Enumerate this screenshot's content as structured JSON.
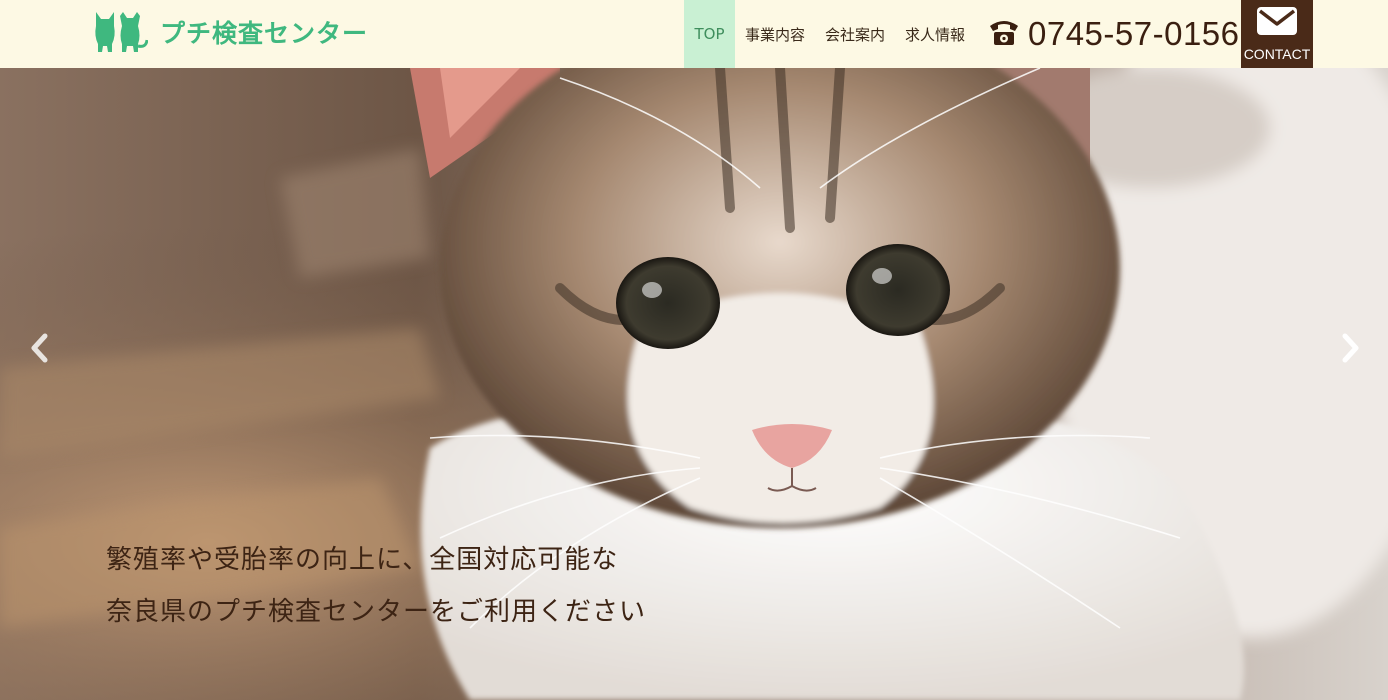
{
  "header": {
    "logo_text": "プチ検査センター",
    "logo_icon": "cat-and-dog-icon",
    "nav": [
      {
        "label": "TOP",
        "active": true
      },
      {
        "label": "事業内容",
        "active": false
      },
      {
        "label": "会社案内",
        "active": false
      },
      {
        "label": "求人情報",
        "active": false
      }
    ],
    "phone_icon": "telephone-icon",
    "phone_number": "0745-57-0156",
    "contact_icon": "envelope-icon",
    "contact_label": "CONTACT"
  },
  "hero": {
    "image": "kitten-closeup-photo",
    "prev_icon": "chevron-left-icon",
    "next_icon": "chevron-right-icon",
    "caption_line1": "繁殖率や受胎率の向上に、全国対応可能な",
    "caption_line2": "奈良県のプチ検査センターをご利用ください"
  },
  "colors": {
    "header_bg": "#fdf9e4",
    "brand_green": "#3fb87f",
    "active_nav_bg": "#c9f0d3",
    "contact_bg": "#4a2a18",
    "text_dark": "#3a1f10"
  }
}
